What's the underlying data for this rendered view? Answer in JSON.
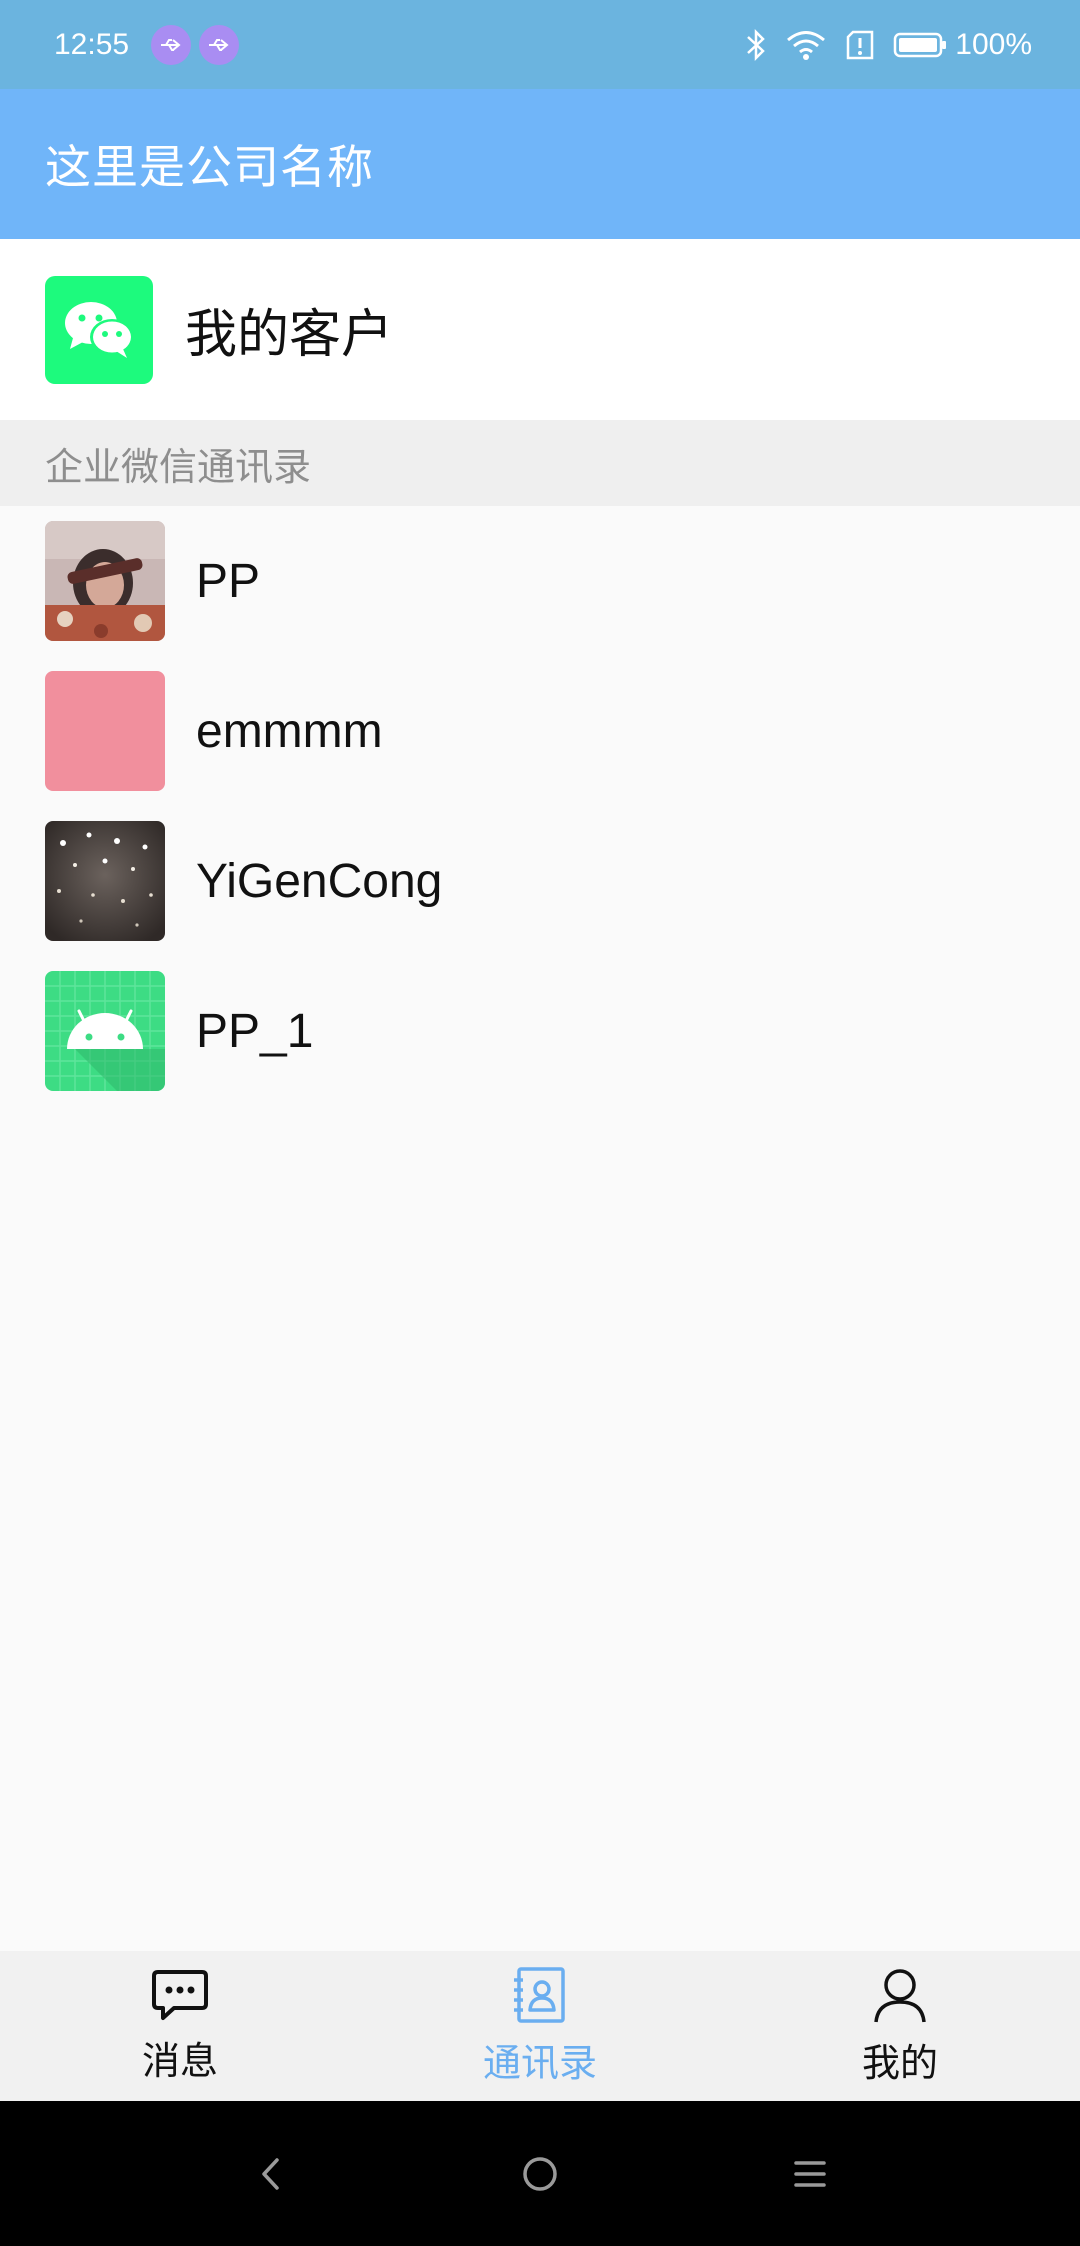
{
  "status_bar": {
    "time": "12:55",
    "battery_text": "100%",
    "icons": [
      "usb-icon",
      "usb-icon",
      "bluetooth-icon",
      "wifi-icon",
      "alert-icon",
      "battery-icon"
    ]
  },
  "app_bar": {
    "title": "这里是公司名称"
  },
  "customer_entry": {
    "label": "我的客户",
    "icon": "wechat-icon"
  },
  "section": {
    "title": "企业微信通讯录"
  },
  "contacts": [
    {
      "name": "PP",
      "avatar": "photo-avatar"
    },
    {
      "name": "emmmm",
      "avatar": "pink-avatar"
    },
    {
      "name": "YiGenCong",
      "avatar": "lights-avatar"
    },
    {
      "name": "PP_1",
      "avatar": "android-avatar"
    }
  ],
  "tabs": [
    {
      "label": "消息",
      "icon": "chat-icon",
      "active": false
    },
    {
      "label": "通讯录",
      "icon": "contacts-icon",
      "active": true
    },
    {
      "label": "我的",
      "icon": "person-icon",
      "active": false
    }
  ],
  "colors": {
    "status_bar": "#6bb4df",
    "app_bar": "#70b5f9",
    "wechat_tile": "#1dfa7d",
    "tab_active": "#6aaef0",
    "tab_inactive": "#111111"
  },
  "nav_bar": {
    "buttons": [
      "back-icon",
      "home-icon",
      "recents-icon"
    ]
  }
}
